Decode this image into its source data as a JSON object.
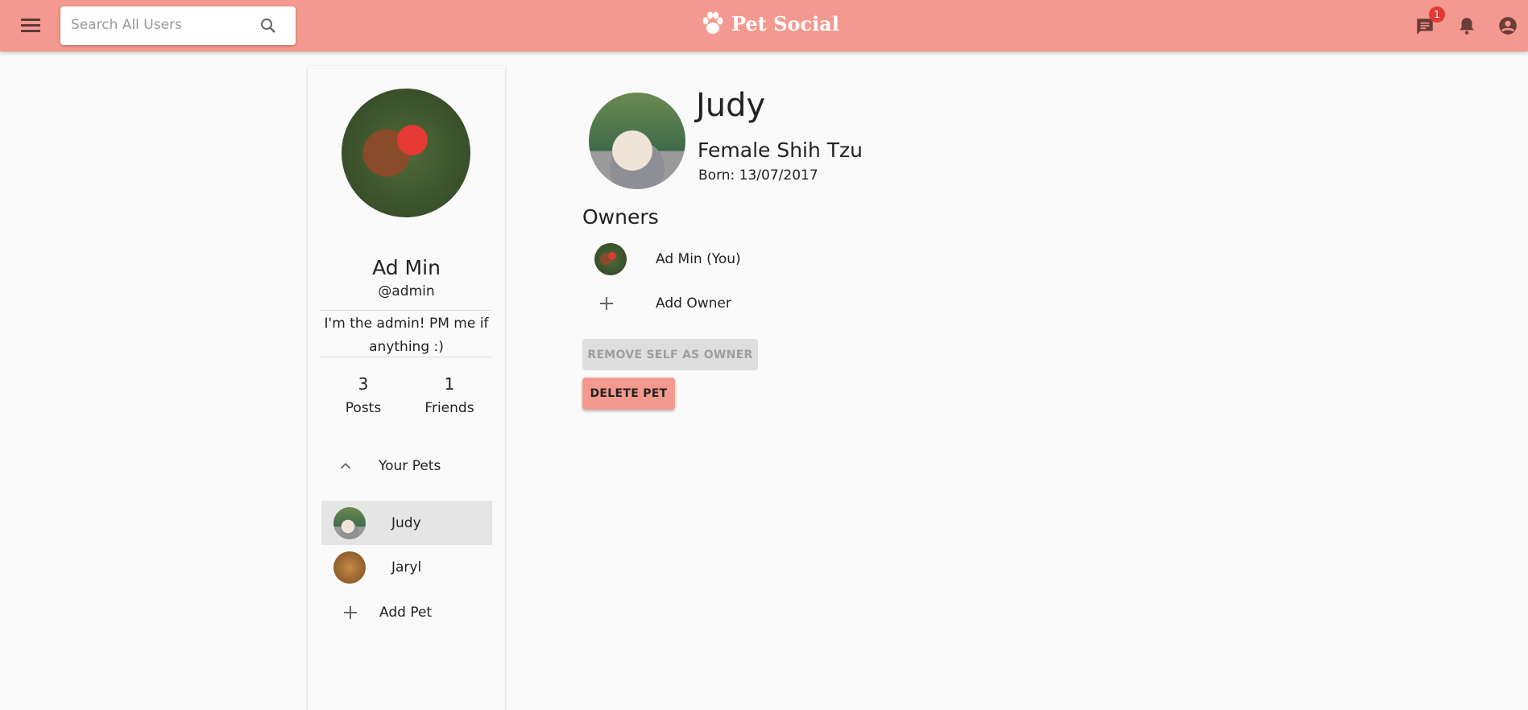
{
  "appbar": {
    "title": "Pet Social",
    "search_placeholder": "Search All Users",
    "message_badge": "1",
    "icons": [
      "menu-icon",
      "search-icon",
      "paw-icon",
      "chat-icon",
      "bell-icon",
      "account-circle-icon"
    ],
    "color": "#f4998f"
  },
  "profile": {
    "name": "Ad Min",
    "username": "@admin",
    "bio": "I'm the admin! PM me if anything :)",
    "posts_count": "3",
    "posts_label": "Posts",
    "friends_count": "1",
    "friends_label": "Friends",
    "pets_section": "Your Pets",
    "pets": [
      {
        "name": "Judy",
        "selected": true
      },
      {
        "name": "Jaryl",
        "selected": false
      }
    ],
    "add_pet": "Add Pet"
  },
  "pet": {
    "name": "Judy",
    "description": "Female Shih Tzu",
    "born": "Born: 13/07/2017",
    "owners_title": "Owners",
    "owners": [
      {
        "name": "Ad Min (You)"
      }
    ],
    "add_owner": "Add Owner",
    "remove_self_label": "REMOVE SELF AS OWNER",
    "delete_label": "DELETE PET"
  }
}
